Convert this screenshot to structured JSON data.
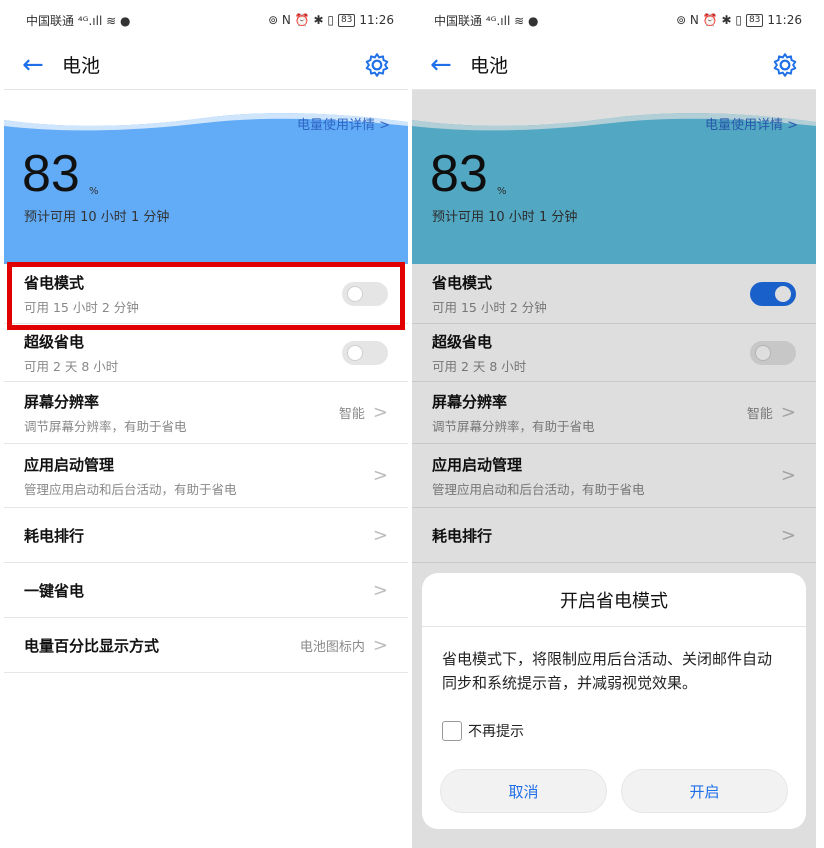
{
  "status_bar": {
    "carrier": "中国联通 ⁴ᴳ.ıll ≋ ●",
    "icons": "⊚ N ⏰ ✱ ▯",
    "battery": "83",
    "time": "11:26"
  },
  "app_bar": {
    "back_icon": "arrow-left-icon",
    "title": "电池",
    "settings_icon": "gear-icon"
  },
  "hero": {
    "details_link": "电量使用详情 >",
    "percent": "83",
    "percent_unit": "%",
    "remaining": "预计可用 10 小时 1 分钟"
  },
  "settings": {
    "power_saving": {
      "label": "省电模式",
      "sub": "可用 15 小时 2 分钟"
    },
    "ultra_power_saving": {
      "label": "超级省电",
      "sub": "可用 2 天 8 小时"
    },
    "screen_resolution": {
      "label": "屏幕分辨率",
      "sub": "调节屏幕分辨率，有助于省电",
      "value": "智能"
    },
    "app_launch": {
      "label": "应用启动管理",
      "sub": "管理应用启动和后台活动，有助于省电"
    },
    "consumption_rank": {
      "label": "耗电排行"
    },
    "one_tap_save": {
      "label": "一键省电"
    },
    "percentage_display": {
      "label": "电量百分比显示方式",
      "value": "电池图标内"
    },
    "chevron": ">"
  },
  "dialog": {
    "title": "开启省电模式",
    "message": "省电模式下，将限制应用后台活动、关闭邮件自动同步和系统提示音，并减弱视觉效果。",
    "checkbox_label": "不再提示",
    "cancel_label": "取消",
    "confirm_label": "开启"
  },
  "state": {
    "left": {
      "power_saving_on": false,
      "ultra_on": false
    },
    "right": {
      "power_saving_on": true,
      "ultra_on": false
    }
  },
  "colors": {
    "accent": "#1e6fe8",
    "hero_left": "#62abf7",
    "hero_right": "#5fc0e0",
    "highlight": "#e00000"
  }
}
